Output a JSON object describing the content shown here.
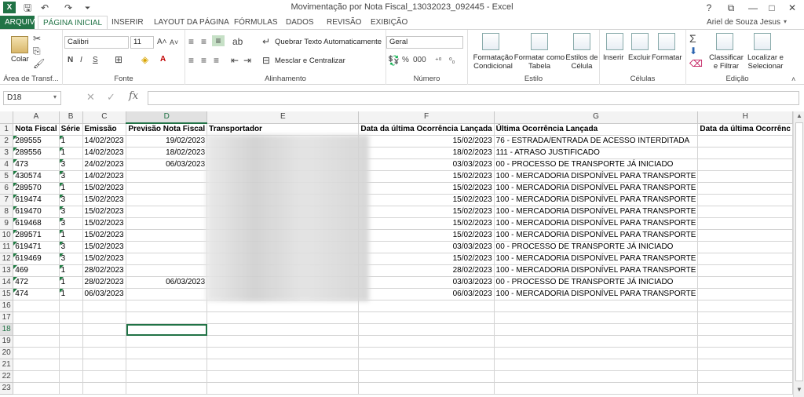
{
  "titlebar": {
    "title": "Movimentação por Nota Fiscal_13032023_092445 - Excel",
    "min": "—",
    "max": "□",
    "close": "✕",
    "help": "?",
    "restore": "⧉"
  },
  "tabs": [
    "ARQUIVO",
    "PÁGINA INICIAL",
    "INSERIR",
    "LAYOUT DA PÁGINA",
    "FÓRMULAS",
    "DADOS",
    "REVISÃO",
    "EXIBIÇÃO"
  ],
  "user": "Ariel de Souza Jesus",
  "ribbon": {
    "clipboard": {
      "paste": "Colar",
      "label": "Área de Transf..."
    },
    "font": {
      "name": "Calibri",
      "size": "11",
      "bold": "N",
      "italic": "I",
      "underline": "S",
      "label": "Fonte"
    },
    "alignment": {
      "wrap": "Quebrar Texto Automaticamente",
      "merge": "Mesclar e Centralizar",
      "label": "Alinhamento"
    },
    "number": {
      "format": "Geral",
      "percent": "%",
      "thousands": "000",
      "label": "Número"
    },
    "styles": {
      "conditional": "Formatação Condicional",
      "table": "Formatar como Tabela",
      "cell": "Estilos de Célula",
      "label": "Estilo"
    },
    "cells": {
      "insert": "Inserir",
      "delete": "Excluir",
      "format": "Formatar",
      "label": "Células"
    },
    "editing": {
      "sort": "Classificar e Filtrar",
      "find": "Localizar e Selecionar",
      "label": "Edição"
    }
  },
  "formula": {
    "namebox": "D18",
    "fx": "fx",
    "value": ""
  },
  "columns": [
    "A",
    "B",
    "C",
    "D",
    "E",
    "F",
    "G",
    "H"
  ],
  "headers": [
    "Nota Fiscal",
    "Série",
    "Emissão",
    "Previsão Nota Fiscal",
    "Transportador",
    "Data da última Ocorrência Lançada",
    "Última Ocorrência Lançada",
    "Data da última Ocorrênc"
  ],
  "rows": [
    [
      "289555",
      "1",
      "14/02/2023",
      "19/02/2023",
      "15/02/2023",
      "76 - ESTRADA/ENTRADA DE ACESSO INTERDITADA"
    ],
    [
      "289556",
      "1",
      "14/02/2023",
      "18/02/2023",
      "18/02/2023",
      "111 - ATRASO JUSTIFICADO"
    ],
    [
      "473",
      "3",
      "24/02/2023",
      "06/03/2023",
      "03/03/2023",
      "00 - PROCESSO DE TRANSPORTE JÁ INICIADO"
    ],
    [
      "430574",
      "3",
      "14/02/2023",
      "",
      "15/02/2023",
      "100 - MERCADORIA DISPONÍVEL PARA TRANSPORTE"
    ],
    [
      "289570",
      "1",
      "15/02/2023",
      "",
      "15/02/2023",
      "100 - MERCADORIA DISPONÍVEL PARA TRANSPORTE"
    ],
    [
      "619474",
      "3",
      "15/02/2023",
      "",
      "15/02/2023",
      "100 - MERCADORIA DISPONÍVEL PARA TRANSPORTE"
    ],
    [
      "619470",
      "3",
      "15/02/2023",
      "",
      "15/02/2023",
      "100 - MERCADORIA DISPONÍVEL PARA TRANSPORTE"
    ],
    [
      "619468",
      "3",
      "15/02/2023",
      "",
      "15/02/2023",
      "100 - MERCADORIA DISPONÍVEL PARA TRANSPORTE"
    ],
    [
      "289571",
      "1",
      "15/02/2023",
      "",
      "15/02/2023",
      "100 - MERCADORIA DISPONÍVEL PARA TRANSPORTE"
    ],
    [
      "619471",
      "3",
      "15/02/2023",
      "",
      "03/03/2023",
      "00 - PROCESSO DE TRANSPORTE JÁ INICIADO"
    ],
    [
      "619469",
      "3",
      "15/02/2023",
      "",
      "15/02/2023",
      "100 - MERCADORIA DISPONÍVEL PARA TRANSPORTE"
    ],
    [
      "469",
      "1",
      "28/02/2023",
      "",
      "28/02/2023",
      "100 - MERCADORIA DISPONÍVEL PARA TRANSPORTE"
    ],
    [
      "472",
      "1",
      "28/02/2023",
      "06/03/2023",
      "03/03/2023",
      "00 - PROCESSO DE TRANSPORTE JÁ INICIADO"
    ],
    [
      "474",
      "1",
      "06/03/2023",
      "",
      "06/03/2023",
      "100 - MERCADORIA DISPONÍVEL PARA TRANSPORTE"
    ]
  ],
  "selected": {
    "col": "D",
    "row": 18
  },
  "total_rows": 23
}
